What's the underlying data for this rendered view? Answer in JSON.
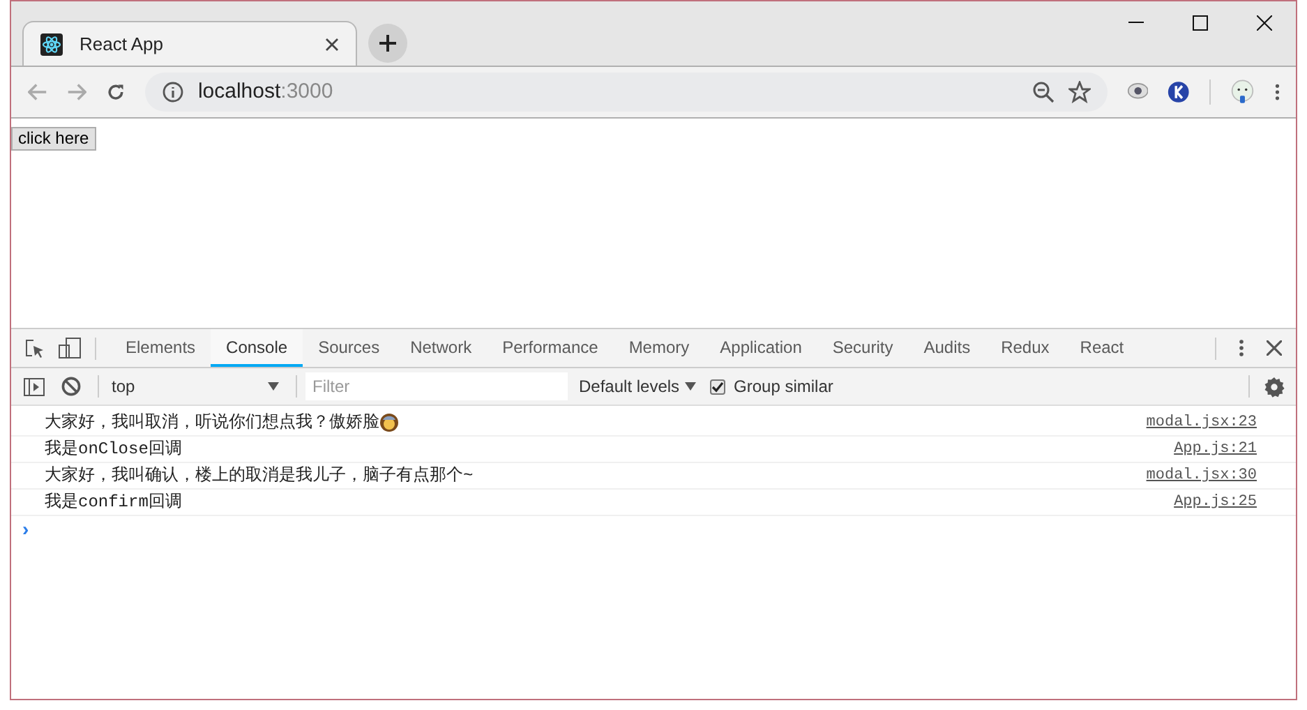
{
  "browser": {
    "tab": {
      "title": "React App",
      "selected": true
    },
    "address": {
      "host": "localhost",
      "port": ":3000"
    }
  },
  "page": {
    "button": "click here"
  },
  "devtools": {
    "tabs": [
      {
        "label": "Elements",
        "selected": false
      },
      {
        "label": "Console",
        "selected": true
      },
      {
        "label": "Sources",
        "selected": false
      },
      {
        "label": "Network",
        "selected": false
      },
      {
        "label": "Performance",
        "selected": false
      },
      {
        "label": "Memory",
        "selected": false
      },
      {
        "label": "Application",
        "selected": false
      },
      {
        "label": "Security",
        "selected": false
      },
      {
        "label": "Audits",
        "selected": false
      },
      {
        "label": "Redux",
        "selected": false
      },
      {
        "label": "React",
        "selected": false
      }
    ],
    "context": "top",
    "filter_placeholder": "Filter",
    "levels": "Default levels",
    "group_similar": {
      "label": "Group similar",
      "checked": true
    },
    "messages": [
      {
        "text": "大家好，我叫取消，听说你们想点我？傲娇脸",
        "emoji": true,
        "source": "modal.jsx:23"
      },
      {
        "text": "我是onClose回调",
        "emoji": false,
        "source": "App.js:21"
      },
      {
        "text": "大家好，我叫确认，楼上的取消是我儿子，脑子有点那个~",
        "emoji": false,
        "source": "modal.jsx:30"
      },
      {
        "text": "我是confirm回调",
        "emoji": false,
        "source": "App.js:25"
      }
    ],
    "prompt": "›"
  }
}
